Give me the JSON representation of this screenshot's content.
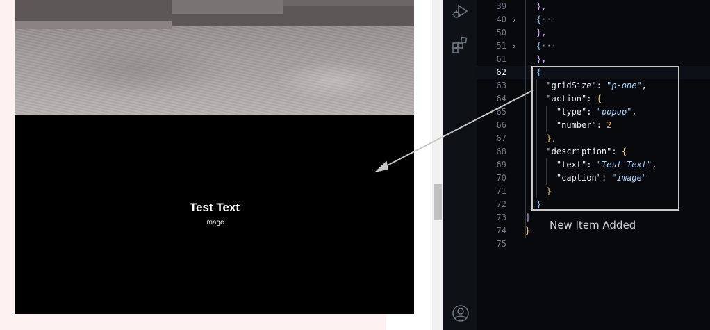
{
  "preview": {
    "card_title": "Test Text",
    "card_caption": "image"
  },
  "activity_bar": {
    "icons": [
      "run-debug-icon",
      "extensions-icon",
      "account-icon"
    ]
  },
  "editor": {
    "lines": [
      {
        "num": "39",
        "tokens": [
          [
            "p",
            "},"
          ]
        ]
      },
      {
        "num": "40",
        "fold": "›",
        "tokens": [
          [
            "b",
            "{"
          ],
          [
            "m",
            "···"
          ]
        ]
      },
      {
        "num": "50",
        "tokens": [
          [
            "p",
            "},"
          ]
        ]
      },
      {
        "num": "51",
        "fold": "›",
        "tokens": [
          [
            "b",
            "{"
          ],
          [
            "m",
            "···"
          ]
        ]
      },
      {
        "num": "61",
        "tokens": [
          [
            "p",
            "},"
          ]
        ]
      },
      {
        "num": "62",
        "active": true,
        "tokens": [
          [
            "b",
            "{"
          ]
        ]
      },
      {
        "num": "63",
        "tokens": [
          [
            "w",
            "  "
          ],
          [
            "k",
            "\"gridSize\""
          ],
          [
            "w",
            ": "
          ],
          [
            "s",
            "\"p-one\""
          ],
          [
            "w",
            ","
          ]
        ]
      },
      {
        "num": "64",
        "tokens": [
          [
            "w",
            "  "
          ],
          [
            "k",
            "\"action\""
          ],
          [
            "w",
            ": "
          ],
          [
            "g",
            "{"
          ]
        ]
      },
      {
        "num": "65",
        "tokens": [
          [
            "w",
            "    "
          ],
          [
            "k",
            "\"type\""
          ],
          [
            "w",
            ": "
          ],
          [
            "s",
            "\"popup\""
          ],
          [
            "w",
            ","
          ]
        ]
      },
      {
        "num": "66",
        "tokens": [
          [
            "w",
            "    "
          ],
          [
            "k",
            "\"number\""
          ],
          [
            "w",
            ": "
          ],
          [
            "n",
            "2"
          ]
        ]
      },
      {
        "num": "67",
        "tokens": [
          [
            "w",
            "  "
          ],
          [
            "g",
            "}"
          ],
          [
            "w",
            ","
          ]
        ]
      },
      {
        "num": "68",
        "tokens": [
          [
            "w",
            "  "
          ],
          [
            "k",
            "\"description\""
          ],
          [
            "w",
            ": "
          ],
          [
            "g",
            "{"
          ]
        ]
      },
      {
        "num": "69",
        "tokens": [
          [
            "w",
            "    "
          ],
          [
            "k",
            "\"text\""
          ],
          [
            "w",
            ": "
          ],
          [
            "s",
            "\"Test Text\""
          ],
          [
            "w",
            ","
          ]
        ]
      },
      {
        "num": "70",
        "tokens": [
          [
            "w",
            "    "
          ],
          [
            "k",
            "\"caption\""
          ],
          [
            "w",
            ": "
          ],
          [
            "s",
            "\"image\""
          ]
        ]
      },
      {
        "num": "71",
        "tokens": [
          [
            "w",
            "  "
          ],
          [
            "g",
            "}"
          ]
        ]
      },
      {
        "num": "72",
        "tokens": [
          [
            "b",
            "}"
          ]
        ]
      },
      {
        "num": "73",
        "indent": "back",
        "tokens": [
          [
            "p",
            "]"
          ]
        ]
      },
      {
        "num": "74",
        "indent": "root",
        "tokens": [
          [
            "g",
            "}"
          ]
        ]
      },
      {
        "num": "75",
        "indent": "root",
        "tokens": []
      }
    ]
  },
  "annotation": {
    "note": "New Item Added"
  },
  "colors": {
    "editor_bg": "#07090c",
    "highlight_box": "#c8c8c8",
    "card_bg": "#000000"
  }
}
